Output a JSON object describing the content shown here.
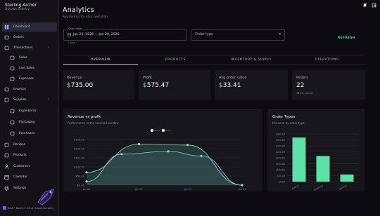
{
  "brand": {
    "name": "Sterling Archer",
    "store": "Uptown Bakery"
  },
  "nav": [
    {
      "label": "Dashboard",
      "icon": "dashboard-icon",
      "active": true,
      "sub": false
    },
    {
      "label": "Orders",
      "icon": "orders-icon",
      "sub": false
    },
    {
      "label": "Transactions",
      "icon": "transactions-icon",
      "sub": false,
      "expandable": true
    },
    {
      "label": "Sales",
      "icon": "sales-icon",
      "sub": true
    },
    {
      "label": "Live Sales",
      "icon": "live-sales-icon",
      "sub": true
    },
    {
      "label": "Expenses",
      "icon": "expenses-icon",
      "sub": true
    },
    {
      "label": "Invoices",
      "icon": "invoices-icon",
      "sub": false
    },
    {
      "label": "Supplies",
      "icon": "supplies-icon",
      "sub": false,
      "expandable": true
    },
    {
      "label": "Ingredients",
      "icon": "ingredients-icon",
      "sub": true
    },
    {
      "label": "Packaging",
      "icon": "packaging-icon",
      "sub": true
    },
    {
      "label": "Purchases",
      "icon": "purchases-icon",
      "sub": true
    },
    {
      "label": "Recipes",
      "icon": "recipes-icon",
      "sub": false
    },
    {
      "label": "Products",
      "icon": "products-icon",
      "sub": false
    },
    {
      "label": "Customers",
      "icon": "customers-icon",
      "sub": false
    },
    {
      "label": "Calendar",
      "icon": "calendar-icon",
      "sub": false
    },
    {
      "label": "Settings",
      "icon": "settings-icon",
      "sub": false
    }
  ],
  "footer": {
    "version": "IN-A • Batch 1.5.0-A (Loupemorphe)"
  },
  "header": {
    "title": "Analytics",
    "subtitle": "Key metrics for your operation."
  },
  "filters": {
    "date_label": "Date range",
    "date_value": "Jan 23, 2026 — Jan 29, 2026",
    "date_hint": "7 days",
    "order_type_placeholder": "Order type",
    "refresh_label": "REFRESH"
  },
  "tabs": [
    "OVERVIEW",
    "PRODUCTS",
    "INVENTORY & SUPPLY",
    "OPERATIONS"
  ],
  "kpis": [
    {
      "label": "Revenue",
      "currency": "$",
      "amount": "735.00",
      "note": ""
    },
    {
      "label": "Profit",
      "currency": "$",
      "amount": "575.47",
      "note": ""
    },
    {
      "label": "Avg order value",
      "currency": "$",
      "amount": "33.41",
      "note": ""
    },
    {
      "label": "Orders",
      "currency": "",
      "amount": "22",
      "note": "78.3% margin"
    }
  ],
  "colors": {
    "accent": "#a9b2ff",
    "green": "#5fe0a8",
    "teal": "#5fd0b0",
    "line_revenue": "#8fe0c8",
    "line_profit": "#9ad0e8"
  },
  "chart_data": [
    {
      "type": "area",
      "title": "Revenue vs profit",
      "subtitle": "Performance in the selected window",
      "categories": [
        "Jan 23",
        "Jan 27",
        "Jan 29",
        "Jan 31"
      ],
      "y_ticks": [
        "$250.00",
        "$200.00",
        "$150.00",
        "$100.00",
        "$50.00",
        "$0.00"
      ],
      "ylim": [
        0,
        250
      ],
      "series": [
        {
          "x": [
            0,
            1.8,
            4.2,
            5.9,
            8
          ],
          "values": [
            20,
            170,
            185,
            160,
            0
          ]
        },
        {
          "x": [
            0,
            2.7,
            5.2,
            8
          ],
          "values": [
            70,
            225,
            220,
            0
          ]
        }
      ]
    },
    {
      "type": "bar",
      "title": "Order Types",
      "subtitle": "Revenue by order type",
      "categories": [
        "Dine-in",
        "Takeaway",
        "Delivery"
      ],
      "y_ticks": [
        "$400.00",
        "$350.00",
        "$300.00",
        "$250.00",
        "$200.00",
        "$150.00",
        "$100.00",
        "$50.00",
        "$0.00"
      ],
      "ylim": [
        0,
        400
      ],
      "values": [
        370,
        215,
        60
      ]
    }
  ]
}
